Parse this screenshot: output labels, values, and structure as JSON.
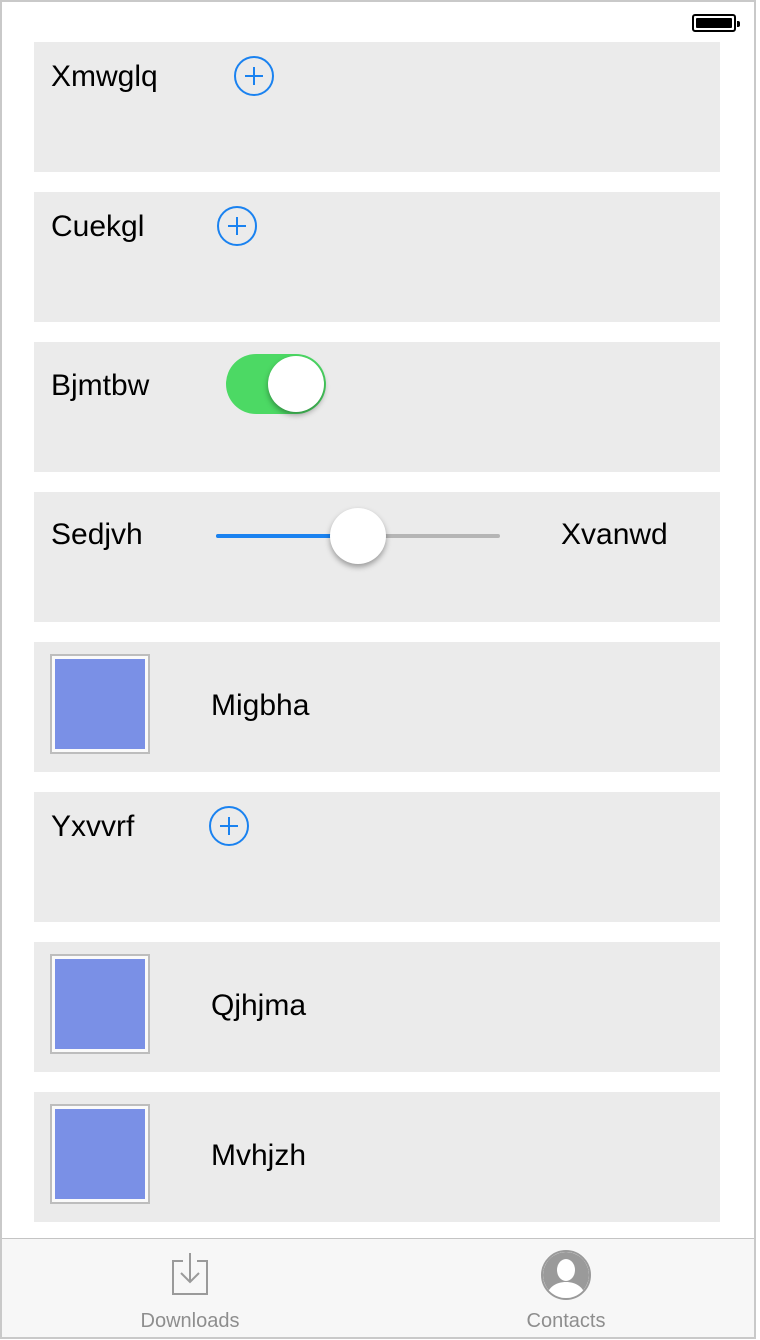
{
  "colors": {
    "accent": "#1a82f0",
    "toggle_on": "#4cd964",
    "row_bg": "#ebebeb",
    "thumbnail": "#7a90e6",
    "tab_inactive": "#8e8e8e"
  },
  "status_bar": {
    "battery_icon": "battery-full-icon"
  },
  "rows": [
    {
      "type": "add",
      "label": "Xmwglq",
      "icon": "plus-circle-icon"
    },
    {
      "type": "add",
      "label": "Cuekgl",
      "icon": "plus-circle-icon"
    },
    {
      "type": "toggle",
      "label": "Bjmtbw",
      "toggle_on": true
    },
    {
      "type": "slider",
      "min_label": "Sedjvh",
      "max_label": "Xvanwd",
      "value_fraction": 0.5
    },
    {
      "type": "image",
      "label": "Migbha"
    },
    {
      "type": "add",
      "label": "Yxvvrf",
      "icon": "plus-circle-icon"
    },
    {
      "type": "image",
      "label": "Qjhjma"
    },
    {
      "type": "image",
      "label": "Mvhjzh"
    }
  ],
  "tabbar": {
    "tabs": [
      {
        "label": "Downloads",
        "icon": "download-tray-icon"
      },
      {
        "label": "Contacts",
        "icon": "person-circle-icon"
      }
    ]
  }
}
